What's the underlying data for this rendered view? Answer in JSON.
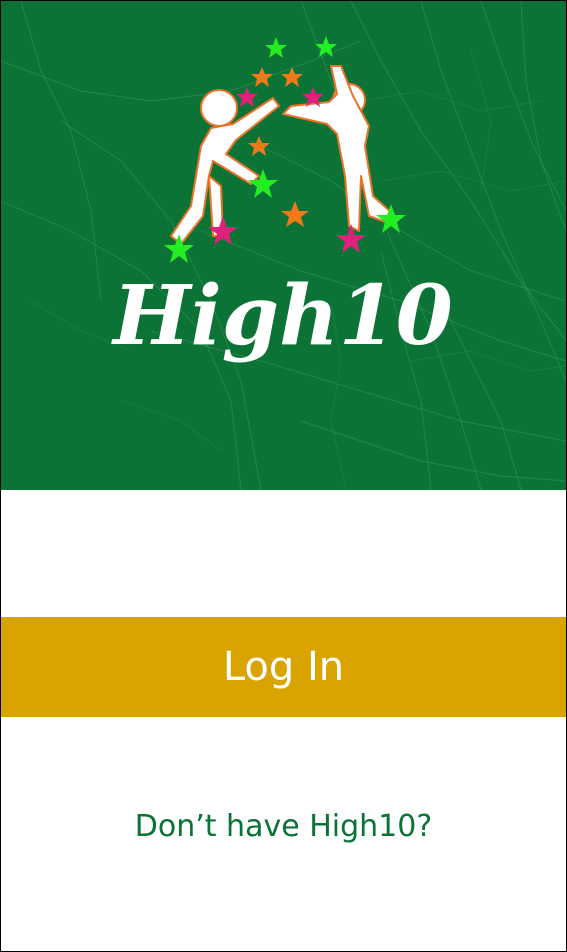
{
  "app": {
    "name": "High10"
  },
  "colors": {
    "hero_background": "#0b7336",
    "login_background": "#d9a300",
    "login_text": "#ffffff",
    "signup_text": "#0b7336",
    "star_green": "#22ee22",
    "star_magenta": "#e0207a",
    "star_orange": "#f07a1a"
  },
  "hero": {
    "logo_icon": "high-five-figures-logo",
    "background_icon": "city-map-pattern"
  },
  "actions": {
    "login_label": "Log In",
    "signup_prompt": "Don’t have High10?"
  }
}
